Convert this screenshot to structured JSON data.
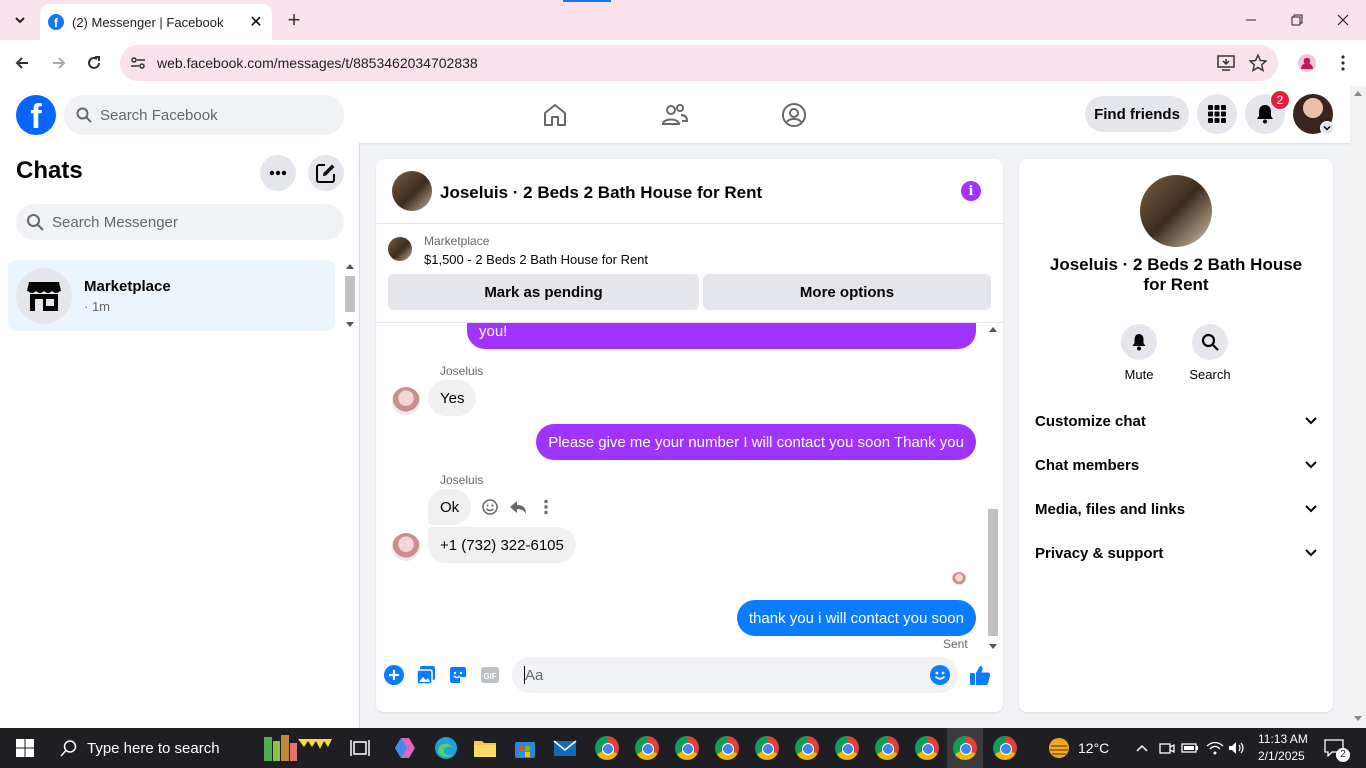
{
  "browser": {
    "tab_title": "(2) Messenger | Facebook",
    "url": "web.facebook.com/messages/t/8853462034702838"
  },
  "header": {
    "search_placeholder": "Search Facebook",
    "find_friends": "Find friends",
    "notification_count": "2"
  },
  "chats": {
    "title": "Chats",
    "search_placeholder": "Search Messenger",
    "items": [
      {
        "name": "Marketplace",
        "time": "· 1m"
      }
    ]
  },
  "conversation": {
    "title": "Joseluis · 2 Beds 2 Bath House for Rent",
    "marketplace_label": "Marketplace",
    "listing": "$1,500 - 2 Beds 2 Bath House for Rent",
    "mark_pending": "Mark as pending",
    "more_options": "More options",
    "messages": {
      "m0": "you!",
      "m1_sender": "Joseluis",
      "m1": "Yes",
      "m2": "Please give me your number I will contact you soon Thank you",
      "m3_sender": "Joseluis",
      "m3": "Ok",
      "m4": "+1 (732) 322-6105",
      "m5": "thank you i will contact you soon",
      "status": "Sent"
    },
    "composer_placeholder": "Aa"
  },
  "details": {
    "name": "Joseluis · 2 Beds 2 Bath House for Rent",
    "mute": "Mute",
    "search": "Search",
    "sections": [
      "Customize chat",
      "Chat members",
      "Media, files and links",
      "Privacy & support"
    ]
  },
  "taskbar": {
    "search_placeholder": "Type here to search",
    "weather": "12°C",
    "time": "11:13 AM",
    "date": "2/1/2025",
    "notification_count": "2"
  },
  "colors": {
    "accent_purple": "#a033ff",
    "messenger_blue": "#0a7cff",
    "facebook_blue": "#0866ff",
    "badge_red": "#e41e3f"
  }
}
